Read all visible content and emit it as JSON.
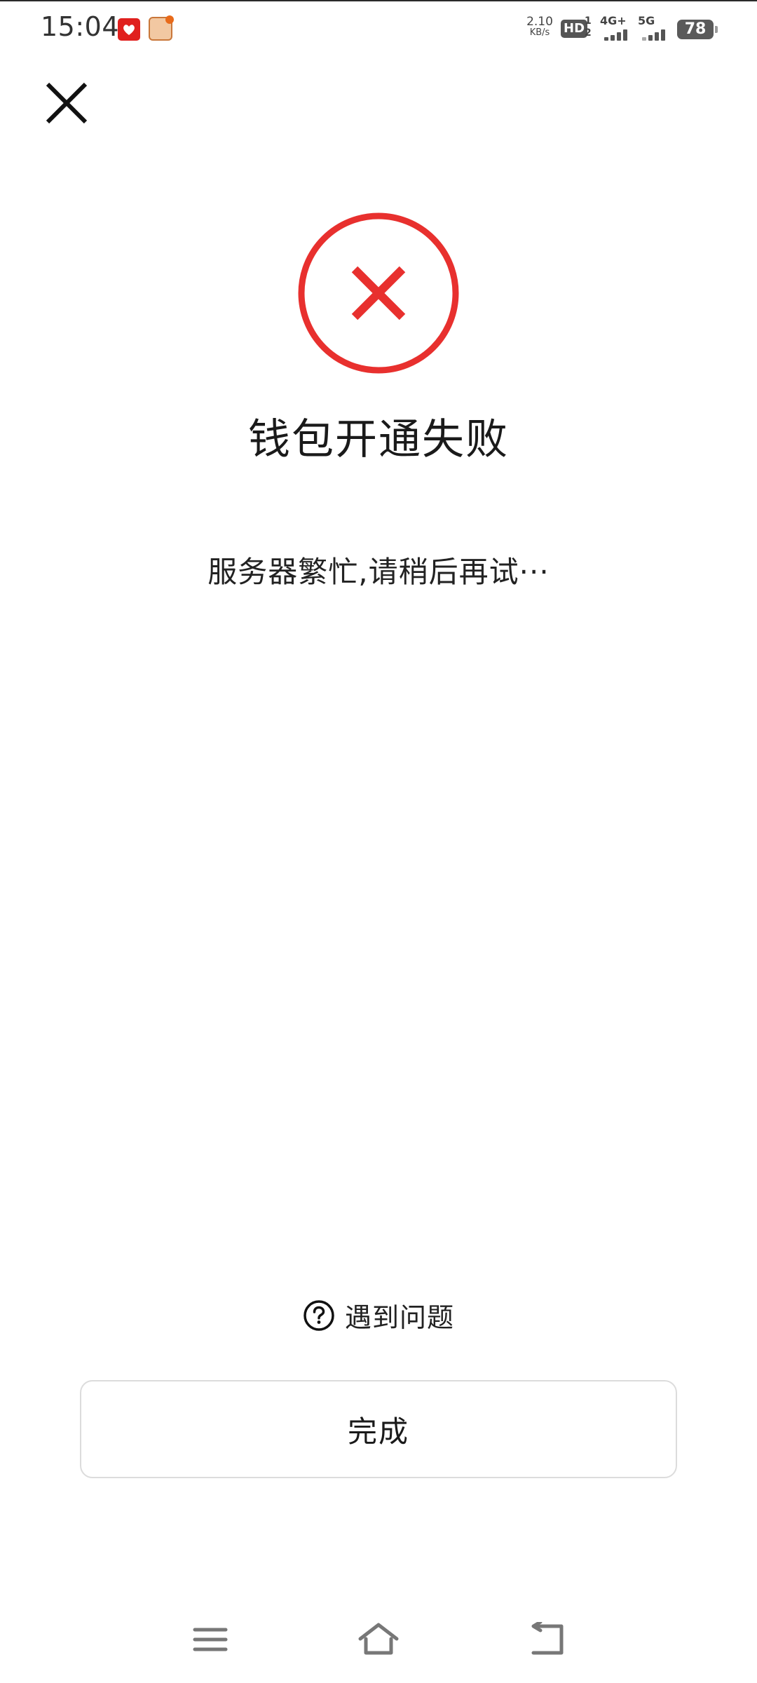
{
  "status_bar": {
    "time": "15:04",
    "net_speed_value": "2.10",
    "net_speed_unit": "KB/s",
    "hd_label": "HD",
    "hd_sub_top": "1",
    "hd_sub_bottom": "2",
    "sim1_label": "4G+",
    "sim2_label": "5G",
    "battery_level": "78",
    "notification_icons": [
      "red-app-icon",
      "cartoon-app-icon"
    ]
  },
  "header": {
    "close_icon": "close-icon"
  },
  "result": {
    "status_icon": "error-circle-x-icon",
    "status_color": "#e8302e",
    "title": "钱包开通失败",
    "message": "服务器繁忙,请稍后再试···"
  },
  "help": {
    "icon": "question-circle-icon",
    "label": "遇到问题"
  },
  "done_button": {
    "label": "完成"
  },
  "nav_bar": {
    "items": [
      "menu-icon",
      "home-icon",
      "back-icon"
    ]
  }
}
